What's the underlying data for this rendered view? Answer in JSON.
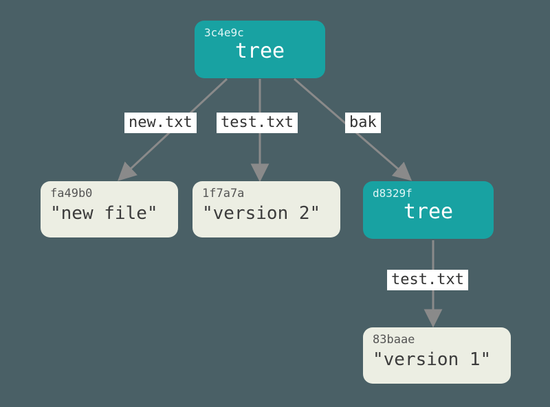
{
  "colors": {
    "tree_bg": "#18a2a2",
    "blob_bg": "#eceee3",
    "page_bg": "#4a6066",
    "arrow": "#888"
  },
  "nodes": {
    "root": {
      "kind": "tree",
      "hash": "3c4e9c",
      "type_label": "tree"
    },
    "new": {
      "kind": "blob",
      "hash": "fa49b0",
      "content": "\"new file\""
    },
    "test": {
      "kind": "blob",
      "hash": "1f7a7a",
      "content": "\"version 2\""
    },
    "subtree": {
      "kind": "tree",
      "hash": "d8329f",
      "type_label": "tree"
    },
    "v1": {
      "kind": "blob",
      "hash": "83baae",
      "content": "\"version 1\""
    }
  },
  "edges": {
    "root_new": {
      "label": "new.txt"
    },
    "root_test": {
      "label": "test.txt"
    },
    "root_subtree": {
      "label": "bak"
    },
    "sub_v1": {
      "label": "test.txt"
    }
  }
}
